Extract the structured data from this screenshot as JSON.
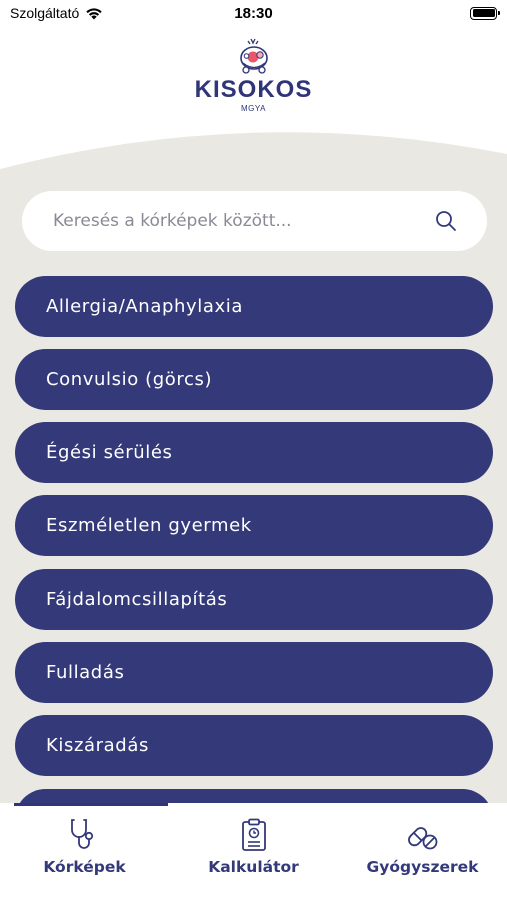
{
  "status_bar": {
    "carrier": "Szolgáltató",
    "time": "18:30"
  },
  "header": {
    "app_name": "KISOKOS",
    "subtitle": "MGYA"
  },
  "search": {
    "placeholder": "Keresés a kórképek között..."
  },
  "list": {
    "items": [
      {
        "label": "Allergia/Anaphylaxia"
      },
      {
        "label": "Convulsio (görcs)"
      },
      {
        "label": "Égési sérülés"
      },
      {
        "label": "Eszméletlen gyermek"
      },
      {
        "label": "Fájdalomcsillapítás"
      },
      {
        "label": "Fulladás"
      },
      {
        "label": "Kiszáradás"
      },
      {
        "label": ""
      }
    ]
  },
  "tabs": [
    {
      "label": "Kórképek",
      "icon": "stethoscope-icon",
      "active": true
    },
    {
      "label": "Kalkulátor",
      "icon": "clipboard-clock-icon",
      "active": false
    },
    {
      "label": "Gyógyszerek",
      "icon": "pill-icon",
      "active": false
    }
  ],
  "colors": {
    "primary": "#343a79",
    "background": "#e9e8e3",
    "surface": "#ffffff"
  }
}
